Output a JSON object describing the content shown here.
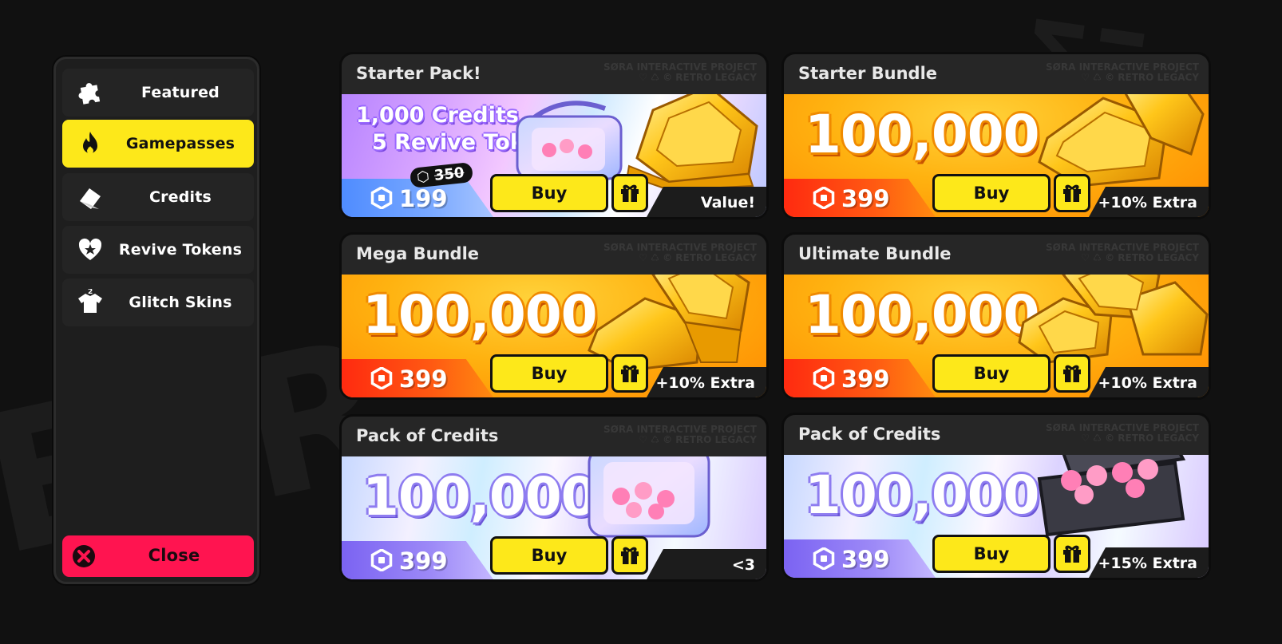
{
  "sidebar": {
    "items": [
      {
        "label": "Featured",
        "icon": "puzzle-icon",
        "active": false
      },
      {
        "label": "Gamepasses",
        "icon": "flame-icon",
        "active": true
      },
      {
        "label": "Credits",
        "icon": "credits-icon",
        "active": false
      },
      {
        "label": "Revive Tokens",
        "icon": "heart-icon",
        "active": false
      },
      {
        "label": "Glitch Skins",
        "icon": "shirt-icon",
        "active": false
      }
    ],
    "close_label": "Close"
  },
  "watermark": {
    "line1": "SØRA INTERACTIVE PROJECT",
    "line2": "♡ ♺ © RETRO LEGACY"
  },
  "cards": [
    {
      "title": "Starter Pack!",
      "line1": "1,000 Credits",
      "line2": "5 Revive Tokens",
      "old_price": "350",
      "price": "199",
      "buy_label": "Buy",
      "tag": "Value!"
    },
    {
      "title": "Starter Bundle",
      "amount": "100,000",
      "price": "399",
      "buy_label": "Buy",
      "tag": "+10% Extra"
    },
    {
      "title": "Mega Bundle",
      "amount": "100,000",
      "price": "399",
      "buy_label": "Buy",
      "tag": "+10% Extra"
    },
    {
      "title": "Ultimate Bundle",
      "amount": "100,000",
      "price": "399",
      "buy_label": "Buy",
      "tag": "+10% Extra"
    },
    {
      "title": "Pack of Credits",
      "amount": "100,000",
      "price": "399",
      "buy_label": "Buy",
      "tag": "<3"
    },
    {
      "title": "Pack of Credits",
      "amount": "100,000",
      "price": "399",
      "buy_label": "Buy",
      "tag": "+15% Extra"
    }
  ],
  "colors": {
    "accent_yellow": "#fde81a",
    "close_red": "#ff1450",
    "background": "#111111"
  }
}
